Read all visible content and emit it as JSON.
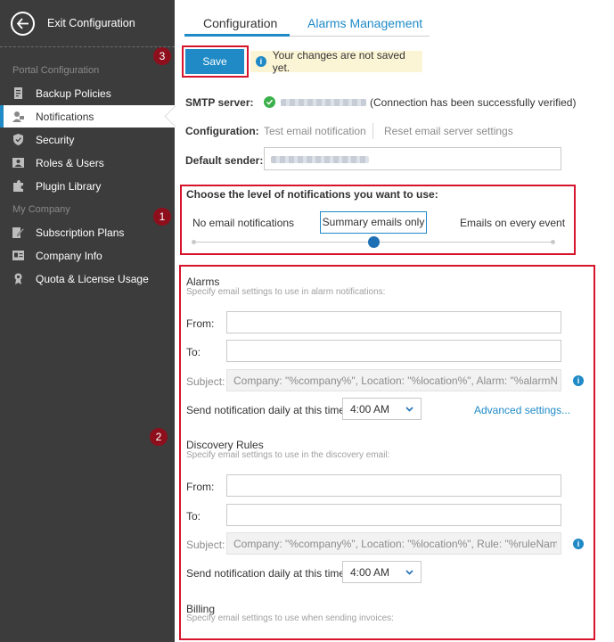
{
  "sidebar": {
    "exit_label": "Exit Configuration",
    "portal_section": "Portal Configuration",
    "company_section": "My Company",
    "items": [
      {
        "label": "Backup Policies",
        "icon": "document-icon"
      },
      {
        "label": "Notifications",
        "icon": "notification-user-icon",
        "active": true
      },
      {
        "label": "Security",
        "icon": "shield-check-icon"
      },
      {
        "label": "Roles & Users",
        "icon": "user-card-icon"
      },
      {
        "label": "Plugin Library",
        "icon": "puzzle-icon"
      },
      {
        "label": "Subscription Plans",
        "icon": "edit-document-icon"
      },
      {
        "label": "Company Info",
        "icon": "id-card-icon"
      },
      {
        "label": "Quota & License Usage",
        "icon": "license-icon"
      }
    ]
  },
  "tabs": [
    {
      "label": "Configuration",
      "active": true
    },
    {
      "label": "Alarms Management",
      "active": false
    }
  ],
  "toolbar": {
    "save_label": "Save",
    "warning_text": "Your changes are not saved yet."
  },
  "callouts": {
    "one": "1",
    "two": "2",
    "three": "3"
  },
  "smtp": {
    "label": "SMTP server:",
    "status_text": "(Connection has been successfully verified)"
  },
  "configuration": {
    "label": "Configuration:",
    "test_link": "Test email notification",
    "reset_link": "Reset email server settings"
  },
  "default_sender": {
    "label": "Default sender:"
  },
  "notification_level": {
    "heading": "Choose the level of notifications you want to use:",
    "options": [
      "No email notifications",
      "Summary emails only",
      "Emails on every event"
    ],
    "selected_index": 1
  },
  "alarms": {
    "title": "Alarms",
    "subtitle": "Specify email settings to use in alarm notifications:",
    "from_label": "From:",
    "to_label": "To:",
    "subject_label": "Subject:",
    "subject_value": "Company: \"%company%\", Location: \"%location%\", Alarm: \"%alarmName%",
    "schedule_label": "Send notification daily at this time:",
    "time": "4:00 AM",
    "advanced_link": "Advanced settings..."
  },
  "discovery": {
    "title": "Discovery Rules",
    "subtitle": "Specify email settings to use in the discovery email:",
    "from_label": "From:",
    "to_label": "To:",
    "subject_label": "Subject:",
    "subject_value": "Company: \"%company%\", Location: \"%location%\", Rule: \"%ruleName%\", St",
    "schedule_label": "Send notification daily at this time:",
    "time": "4:00 AM"
  },
  "billing": {
    "title": "Billing",
    "subtitle": "Specify email settings to use when sending invoices:"
  },
  "colors": {
    "accent": "#1f8ac6",
    "sidebar_bg": "#3c3c3c",
    "highlight_red": "#d6142c",
    "callout_badge": "#8e0f1c",
    "warning_bg": "#fcf5d5",
    "success_green": "#3cb04a"
  }
}
